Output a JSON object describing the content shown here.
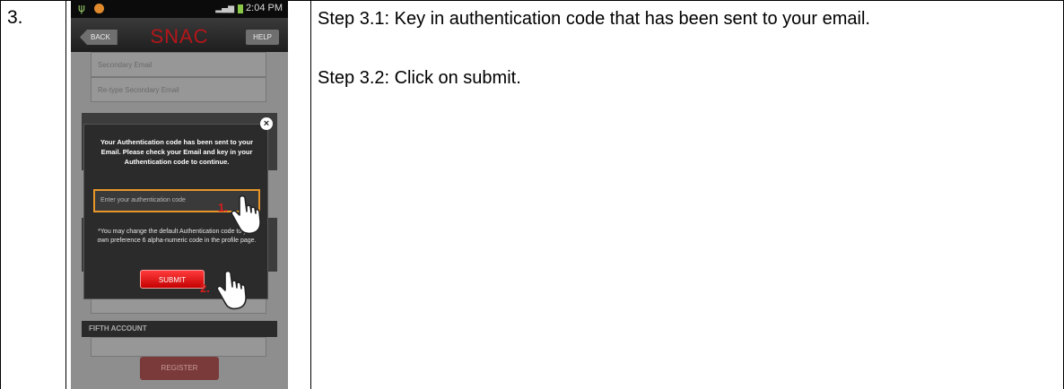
{
  "step": {
    "number": "3."
  },
  "instructions": {
    "line1": "Step 3.1: Key in authentication code that has been sent to your email.",
    "line2": "Step 3.2: Click on submit."
  },
  "phone": {
    "status_time": "2:04 PM",
    "app": {
      "back_label": "BACK",
      "title": "SNAC",
      "help_label": "HELP"
    },
    "background_form": {
      "field1_placeholder": "Secondary Email",
      "field2_placeholder": "Re-type Secondary Email",
      "section_header": "FIFTH ACCOUNT",
      "register_label": "REGISTER"
    },
    "dialog": {
      "message": "Your Authentication code has been sent to your Email. Please check your Email and key in your Authentication code to continue.",
      "input_placeholder": "Enter your authentication code",
      "note": "*You may change the default Authentication code to your own preference 6 alpha-numeric code in the profile page.",
      "submit_label": "SUBMIT",
      "close_symbol": "×"
    },
    "callouts": {
      "first": "1.",
      "second": "2."
    }
  },
  "colors": {
    "accent_red": "#c40000",
    "input_border": "#e8962a",
    "title_red": "#b5161a"
  }
}
